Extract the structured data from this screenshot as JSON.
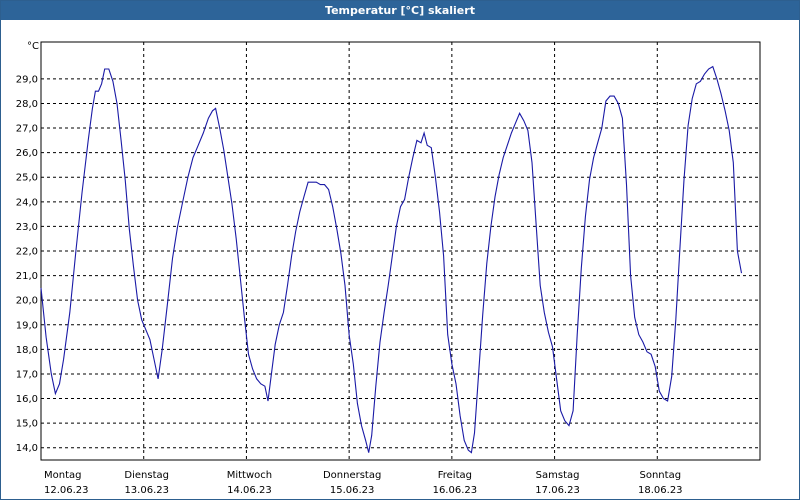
{
  "window": {
    "title": "Temperatur [°C] skaliert"
  },
  "colors": {
    "title_bar": "#2d6499",
    "line": "#1a1aa6",
    "grid": "#000000"
  },
  "chart_data": {
    "type": "line",
    "title": "Temperatur [°C] skaliert",
    "ylabel": "°C",
    "xlabel": "",
    "ylim": [
      13.5,
      30.5
    ],
    "yticks": [
      "14,0",
      "15,0",
      "16,0",
      "17,0",
      "18,0",
      "19,0",
      "20,0",
      "21,0",
      "22,0",
      "23,0",
      "24,0",
      "25,0",
      "26,0",
      "27,0",
      "28,0",
      "29,0"
    ],
    "ytick_values": [
      14,
      15,
      16,
      17,
      18,
      19,
      20,
      21,
      22,
      23,
      24,
      25,
      26,
      27,
      28,
      29
    ],
    "x_unit": "day",
    "xlim": [
      0,
      7
    ],
    "days": [
      {
        "day": "Montag",
        "date": "12.06.23"
      },
      {
        "day": "Dienstag",
        "date": "13.06.23"
      },
      {
        "day": "Mittwoch",
        "date": "14.06.23"
      },
      {
        "day": "Donnerstag",
        "date": "15.06.23"
      },
      {
        "day": "Freitag",
        "date": "16.06.23"
      },
      {
        "day": "Samstag",
        "date": "17.06.23"
      },
      {
        "day": "Sonntag",
        "date": "18.06.23"
      }
    ],
    "grid": true,
    "series": [
      {
        "values": [
          [
            0.0,
            20.5
          ],
          [
            0.05,
            18.5
          ],
          [
            0.1,
            17.0
          ],
          [
            0.14,
            16.2
          ],
          [
            0.18,
            16.6
          ],
          [
            0.22,
            17.6
          ],
          [
            0.28,
            19.5
          ],
          [
            0.34,
            22.0
          ],
          [
            0.4,
            24.4
          ],
          [
            0.46,
            26.5
          ],
          [
            0.5,
            27.8
          ],
          [
            0.53,
            28.5
          ],
          [
            0.56,
            28.5
          ],
          [
            0.59,
            28.8
          ],
          [
            0.62,
            29.4
          ],
          [
            0.66,
            29.4
          ],
          [
            0.7,
            28.9
          ],
          [
            0.74,
            28.0
          ],
          [
            0.78,
            26.5
          ],
          [
            0.82,
            24.9
          ],
          [
            0.86,
            22.9
          ],
          [
            0.9,
            21.4
          ],
          [
            0.94,
            20.0
          ],
          [
            0.98,
            19.2
          ],
          [
            1.02,
            18.8
          ],
          [
            1.06,
            18.4
          ],
          [
            1.1,
            17.6
          ],
          [
            1.14,
            16.8
          ],
          [
            1.18,
            18.0
          ],
          [
            1.23,
            19.8
          ],
          [
            1.28,
            21.7
          ],
          [
            1.33,
            23.0
          ],
          [
            1.38,
            24.0
          ],
          [
            1.43,
            25.0
          ],
          [
            1.48,
            25.8
          ],
          [
            1.53,
            26.3
          ],
          [
            1.58,
            26.8
          ],
          [
            1.63,
            27.4
          ],
          [
            1.67,
            27.7
          ],
          [
            1.7,
            27.8
          ],
          [
            1.74,
            27.0
          ],
          [
            1.78,
            26.1
          ],
          [
            1.82,
            25.0
          ],
          [
            1.86,
            23.9
          ],
          [
            1.9,
            22.5
          ],
          [
            1.94,
            20.9
          ],
          [
            1.98,
            19.3
          ],
          [
            2.02,
            17.8
          ],
          [
            2.06,
            17.2
          ],
          [
            2.1,
            16.8
          ],
          [
            2.14,
            16.6
          ],
          [
            2.18,
            16.5
          ],
          [
            2.21,
            15.9
          ],
          [
            2.24,
            16.9
          ],
          [
            2.28,
            18.2
          ],
          [
            2.32,
            19.0
          ],
          [
            2.36,
            19.5
          ],
          [
            2.4,
            20.6
          ],
          [
            2.44,
            21.8
          ],
          [
            2.48,
            22.8
          ],
          [
            2.52,
            23.6
          ],
          [
            2.56,
            24.2
          ],
          [
            2.6,
            24.8
          ],
          [
            2.64,
            24.8
          ],
          [
            2.68,
            24.8
          ],
          [
            2.72,
            24.7
          ],
          [
            2.76,
            24.7
          ],
          [
            2.8,
            24.5
          ],
          [
            2.84,
            23.8
          ],
          [
            2.88,
            22.9
          ],
          [
            2.92,
            21.9
          ],
          [
            2.96,
            20.6
          ],
          [
            3.0,
            18.6
          ],
          [
            3.04,
            17.4
          ],
          [
            3.08,
            15.8
          ],
          [
            3.12,
            14.9
          ],
          [
            3.16,
            14.3
          ],
          [
            3.19,
            13.8
          ],
          [
            3.22,
            14.5
          ],
          [
            3.26,
            16.5
          ],
          [
            3.3,
            18.3
          ],
          [
            3.34,
            19.5
          ],
          [
            3.38,
            20.6
          ],
          [
            3.42,
            21.8
          ],
          [
            3.46,
            23.0
          ],
          [
            3.5,
            23.8
          ],
          [
            3.54,
            24.1
          ],
          [
            3.58,
            25.0
          ],
          [
            3.62,
            25.8
          ],
          [
            3.66,
            26.5
          ],
          [
            3.7,
            26.4
          ],
          [
            3.73,
            26.8
          ],
          [
            3.76,
            26.3
          ],
          [
            3.8,
            26.2
          ],
          [
            3.84,
            25.0
          ],
          [
            3.88,
            23.6
          ],
          [
            3.92,
            21.8
          ],
          [
            3.96,
            18.6
          ],
          [
            4.0,
            17.4
          ],
          [
            4.04,
            16.6
          ],
          [
            4.08,
            15.3
          ],
          [
            4.12,
            14.3
          ],
          [
            4.16,
            13.9
          ],
          [
            4.19,
            13.8
          ],
          [
            4.22,
            14.6
          ],
          [
            4.26,
            17.0
          ],
          [
            4.3,
            19.4
          ],
          [
            4.34,
            21.5
          ],
          [
            4.38,
            23.0
          ],
          [
            4.42,
            24.2
          ],
          [
            4.46,
            25.1
          ],
          [
            4.5,
            25.8
          ],
          [
            4.54,
            26.3
          ],
          [
            4.58,
            26.8
          ],
          [
            4.62,
            27.2
          ],
          [
            4.66,
            27.6
          ],
          [
            4.7,
            27.3
          ],
          [
            4.74,
            26.9
          ],
          [
            4.78,
            25.6
          ],
          [
            4.82,
            23.1
          ],
          [
            4.86,
            20.6
          ],
          [
            4.9,
            19.5
          ],
          [
            4.94,
            18.7
          ],
          [
            4.98,
            18.1
          ],
          [
            5.02,
            16.8
          ],
          [
            5.06,
            15.5
          ],
          [
            5.1,
            15.1
          ],
          [
            5.14,
            14.9
          ],
          [
            5.18,
            15.5
          ],
          [
            5.22,
            18.6
          ],
          [
            5.26,
            21.3
          ],
          [
            5.3,
            23.4
          ],
          [
            5.34,
            24.9
          ],
          [
            5.38,
            25.8
          ],
          [
            5.42,
            26.4
          ],
          [
            5.46,
            27.0
          ],
          [
            5.5,
            28.1
          ],
          [
            5.54,
            28.3
          ],
          [
            5.58,
            28.3
          ],
          [
            5.62,
            28.0
          ],
          [
            5.66,
            27.4
          ],
          [
            5.7,
            24.7
          ],
          [
            5.74,
            21.0
          ],
          [
            5.78,
            19.3
          ],
          [
            5.82,
            18.6
          ],
          [
            5.86,
            18.3
          ],
          [
            5.9,
            17.9
          ],
          [
            5.94,
            17.8
          ],
          [
            5.98,
            17.3
          ],
          [
            6.02,
            16.3
          ],
          [
            6.06,
            16.0
          ],
          [
            6.1,
            15.9
          ],
          [
            6.14,
            16.9
          ],
          [
            6.18,
            19.2
          ],
          [
            6.22,
            22.1
          ],
          [
            6.26,
            24.9
          ],
          [
            6.3,
            27.1
          ],
          [
            6.34,
            28.2
          ],
          [
            6.38,
            28.8
          ],
          [
            6.42,
            28.9
          ],
          [
            6.46,
            29.2
          ],
          [
            6.5,
            29.4
          ],
          [
            6.54,
            29.5
          ],
          [
            6.58,
            29.0
          ],
          [
            6.62,
            28.4
          ],
          [
            6.66,
            27.7
          ],
          [
            6.7,
            26.9
          ],
          [
            6.74,
            25.6
          ],
          [
            6.78,
            22.0
          ],
          [
            6.82,
            21.1
          ]
        ]
      }
    ]
  }
}
